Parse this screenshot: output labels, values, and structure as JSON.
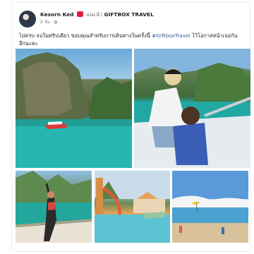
{
  "post": {
    "author": "Kesorn Ked",
    "recommend_text": "แนะนำ",
    "page_name": "GIFTBOX TRAVEL",
    "time": "2 วัน",
    "body_text": "ไปครบ จบในทริปเดียว ขอบคุณสำหรับการเดินทางในครั้งนี้ ",
    "hashtag": "#GiftboxTravel",
    "body_text_end": " ไว้โอกาสหน้าเจอกันอีกนะคะ"
  },
  "photos": [
    {
      "name": "limestone-lagoon-photo"
    },
    {
      "name": "boat-child-photo"
    },
    {
      "name": "boat-woman-photo"
    },
    {
      "name": "pool-resort-photo"
    },
    {
      "name": "beach-parasail-photo"
    }
  ],
  "colors": {
    "text": "#1c1e21",
    "muted": "#65676b",
    "link": "#385898",
    "badge": "#e41e3f"
  },
  "icons": {
    "recommend": "red-recommend-badge-icon",
    "privacy": "globe-icon"
  }
}
